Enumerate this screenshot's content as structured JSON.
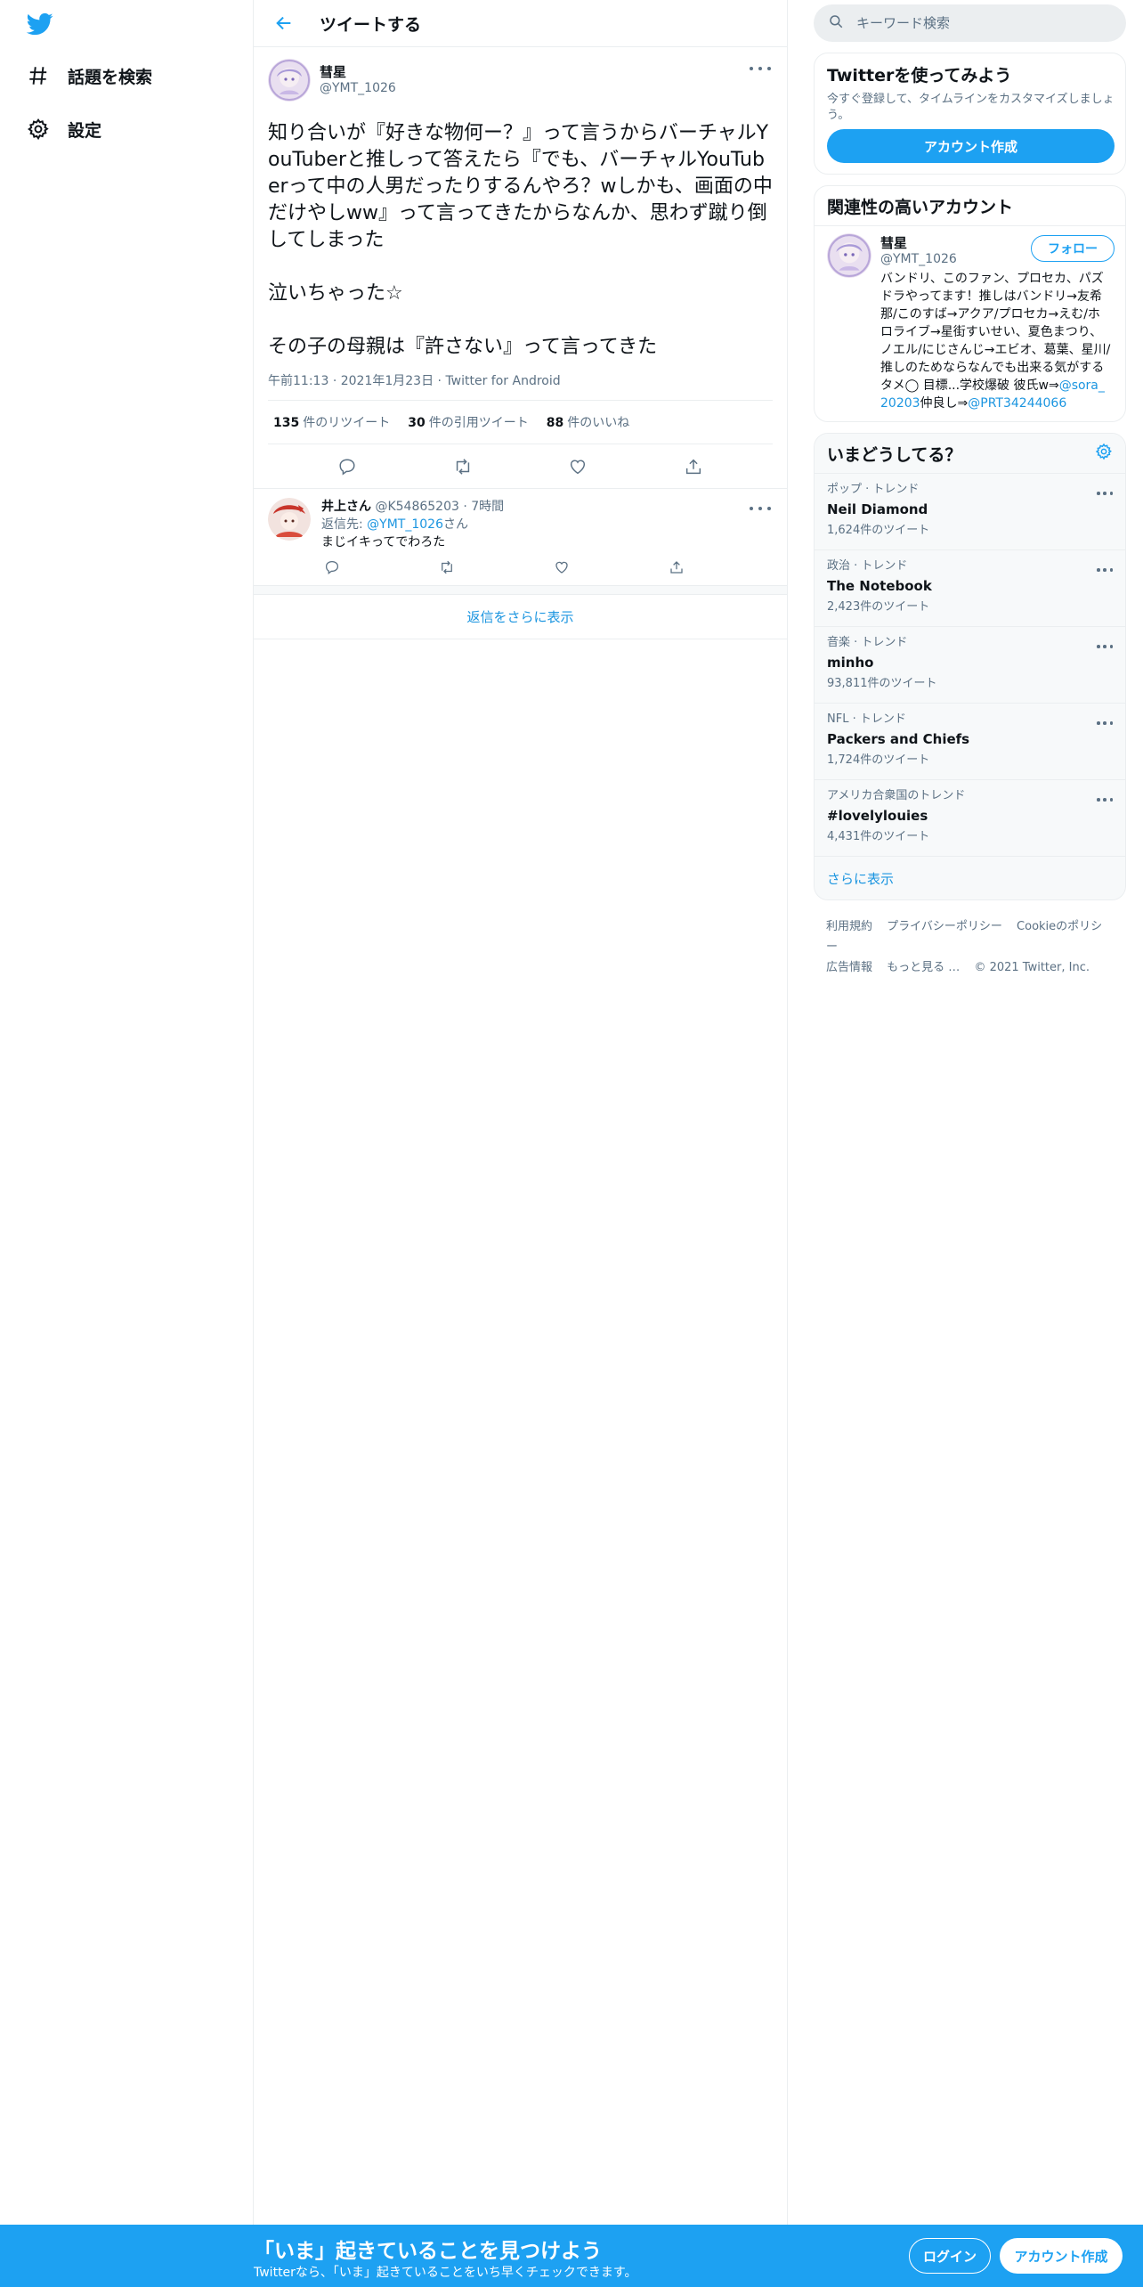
{
  "nav": {
    "items": [
      {
        "label": "話題を検索",
        "icon": "hashtag-icon"
      },
      {
        "label": "設定",
        "icon": "gear-icon"
      }
    ]
  },
  "header": {
    "title": "ツイートする"
  },
  "tweet": {
    "author_name": "彗星",
    "author_handle": "@YMT_1026",
    "text": "知り合いが『好きな物何ー？』って言うからバーチャルYouTuberと推しって答えたら『でも、バーチャルYouTuberって中の人男だったりするんやろ？wしかも、画面の中だけやしww』って言ってきたからなんか、思わず蹴り倒してしまった\n\n泣いちゃった☆\n\nその子の母親は『許さない』って言ってきた",
    "time": "午前11:13",
    "date": "2021年1月23日",
    "source": "Twitter for Android",
    "retweets_count": "135",
    "retweets_label": "件のリツイート",
    "quotes_count": "30",
    "quotes_label": "件の引用ツイート",
    "likes_count": "88",
    "likes_label": "件のいいね"
  },
  "reply": {
    "author_name": "井上さん",
    "author_handle": "@K54865203",
    "time": "7時間",
    "replying_to_label": "返信先:",
    "replying_to_handle": "@YMT_1026",
    "replying_to_suffix": "さん",
    "text": "まじイキってでわろた"
  },
  "show_more_replies": "返信をさらに表示",
  "search": {
    "placeholder": "キーワード検索"
  },
  "signup_card": {
    "title": "Twitterを使ってみよう",
    "text": "今すぐ登録して、タイムラインをカスタマイズしましょう。",
    "button": "アカウント作成"
  },
  "related": {
    "title": "関連性の高いアカウント",
    "name": "彗星",
    "handle": "@YMT_1026",
    "follow_label": "フォロー",
    "bio_text": "バンドリ、このファン、プロセカ、パズドラやってます！推しはバンドリ→友希那/このすば→アクア/プロセカ→えむ/ホロライブ→星街すいせい、夏色まつり、ノエル/にじさんじ→エビオ、葛葉、星川/ 推しのためならなんでも出来る気がする タメ◯ 目標...学校爆破 彼氏w⇒",
    "bio_link1": "@sora_20203",
    "bio_mid": "仲良し⇒",
    "bio_link2": "@PRT34244066"
  },
  "trends": {
    "title": "いまどうしてる？",
    "items": [
      {
        "context": "ポップ · トレンド",
        "name": "Neil Diamond",
        "count": "1,624件のツイート"
      },
      {
        "context": "政治 · トレンド",
        "name": "The Notebook",
        "count": "2,423件のツイート"
      },
      {
        "context": "音楽 · トレンド",
        "name": "minho",
        "count": "93,811件のツイート"
      },
      {
        "context": "NFL · トレンド",
        "name": "Packers and Chiefs",
        "count": "1,724件のツイート"
      },
      {
        "context": "アメリカ合衆国のトレンド",
        "name": "#lovelylouies",
        "count": "4,431件のツイート"
      }
    ],
    "show_more": "さらに表示"
  },
  "footer": {
    "links": [
      "利用規約",
      "プライバシーポリシー",
      "Cookieのポリシー",
      "広告情報",
      "もっと見る …"
    ],
    "copyright": "© 2021 Twitter, Inc."
  },
  "bottom_bar": {
    "title": "「いま」起きていることを見つけよう",
    "subtitle": "Twitterなら、「いま」起きていることをいち早くチェックできます。",
    "login": "ログイン",
    "signup": "アカウント作成"
  },
  "colors": {
    "brand": "#1da1f2",
    "link": "#1b95e0",
    "muted": "#5b7083"
  }
}
